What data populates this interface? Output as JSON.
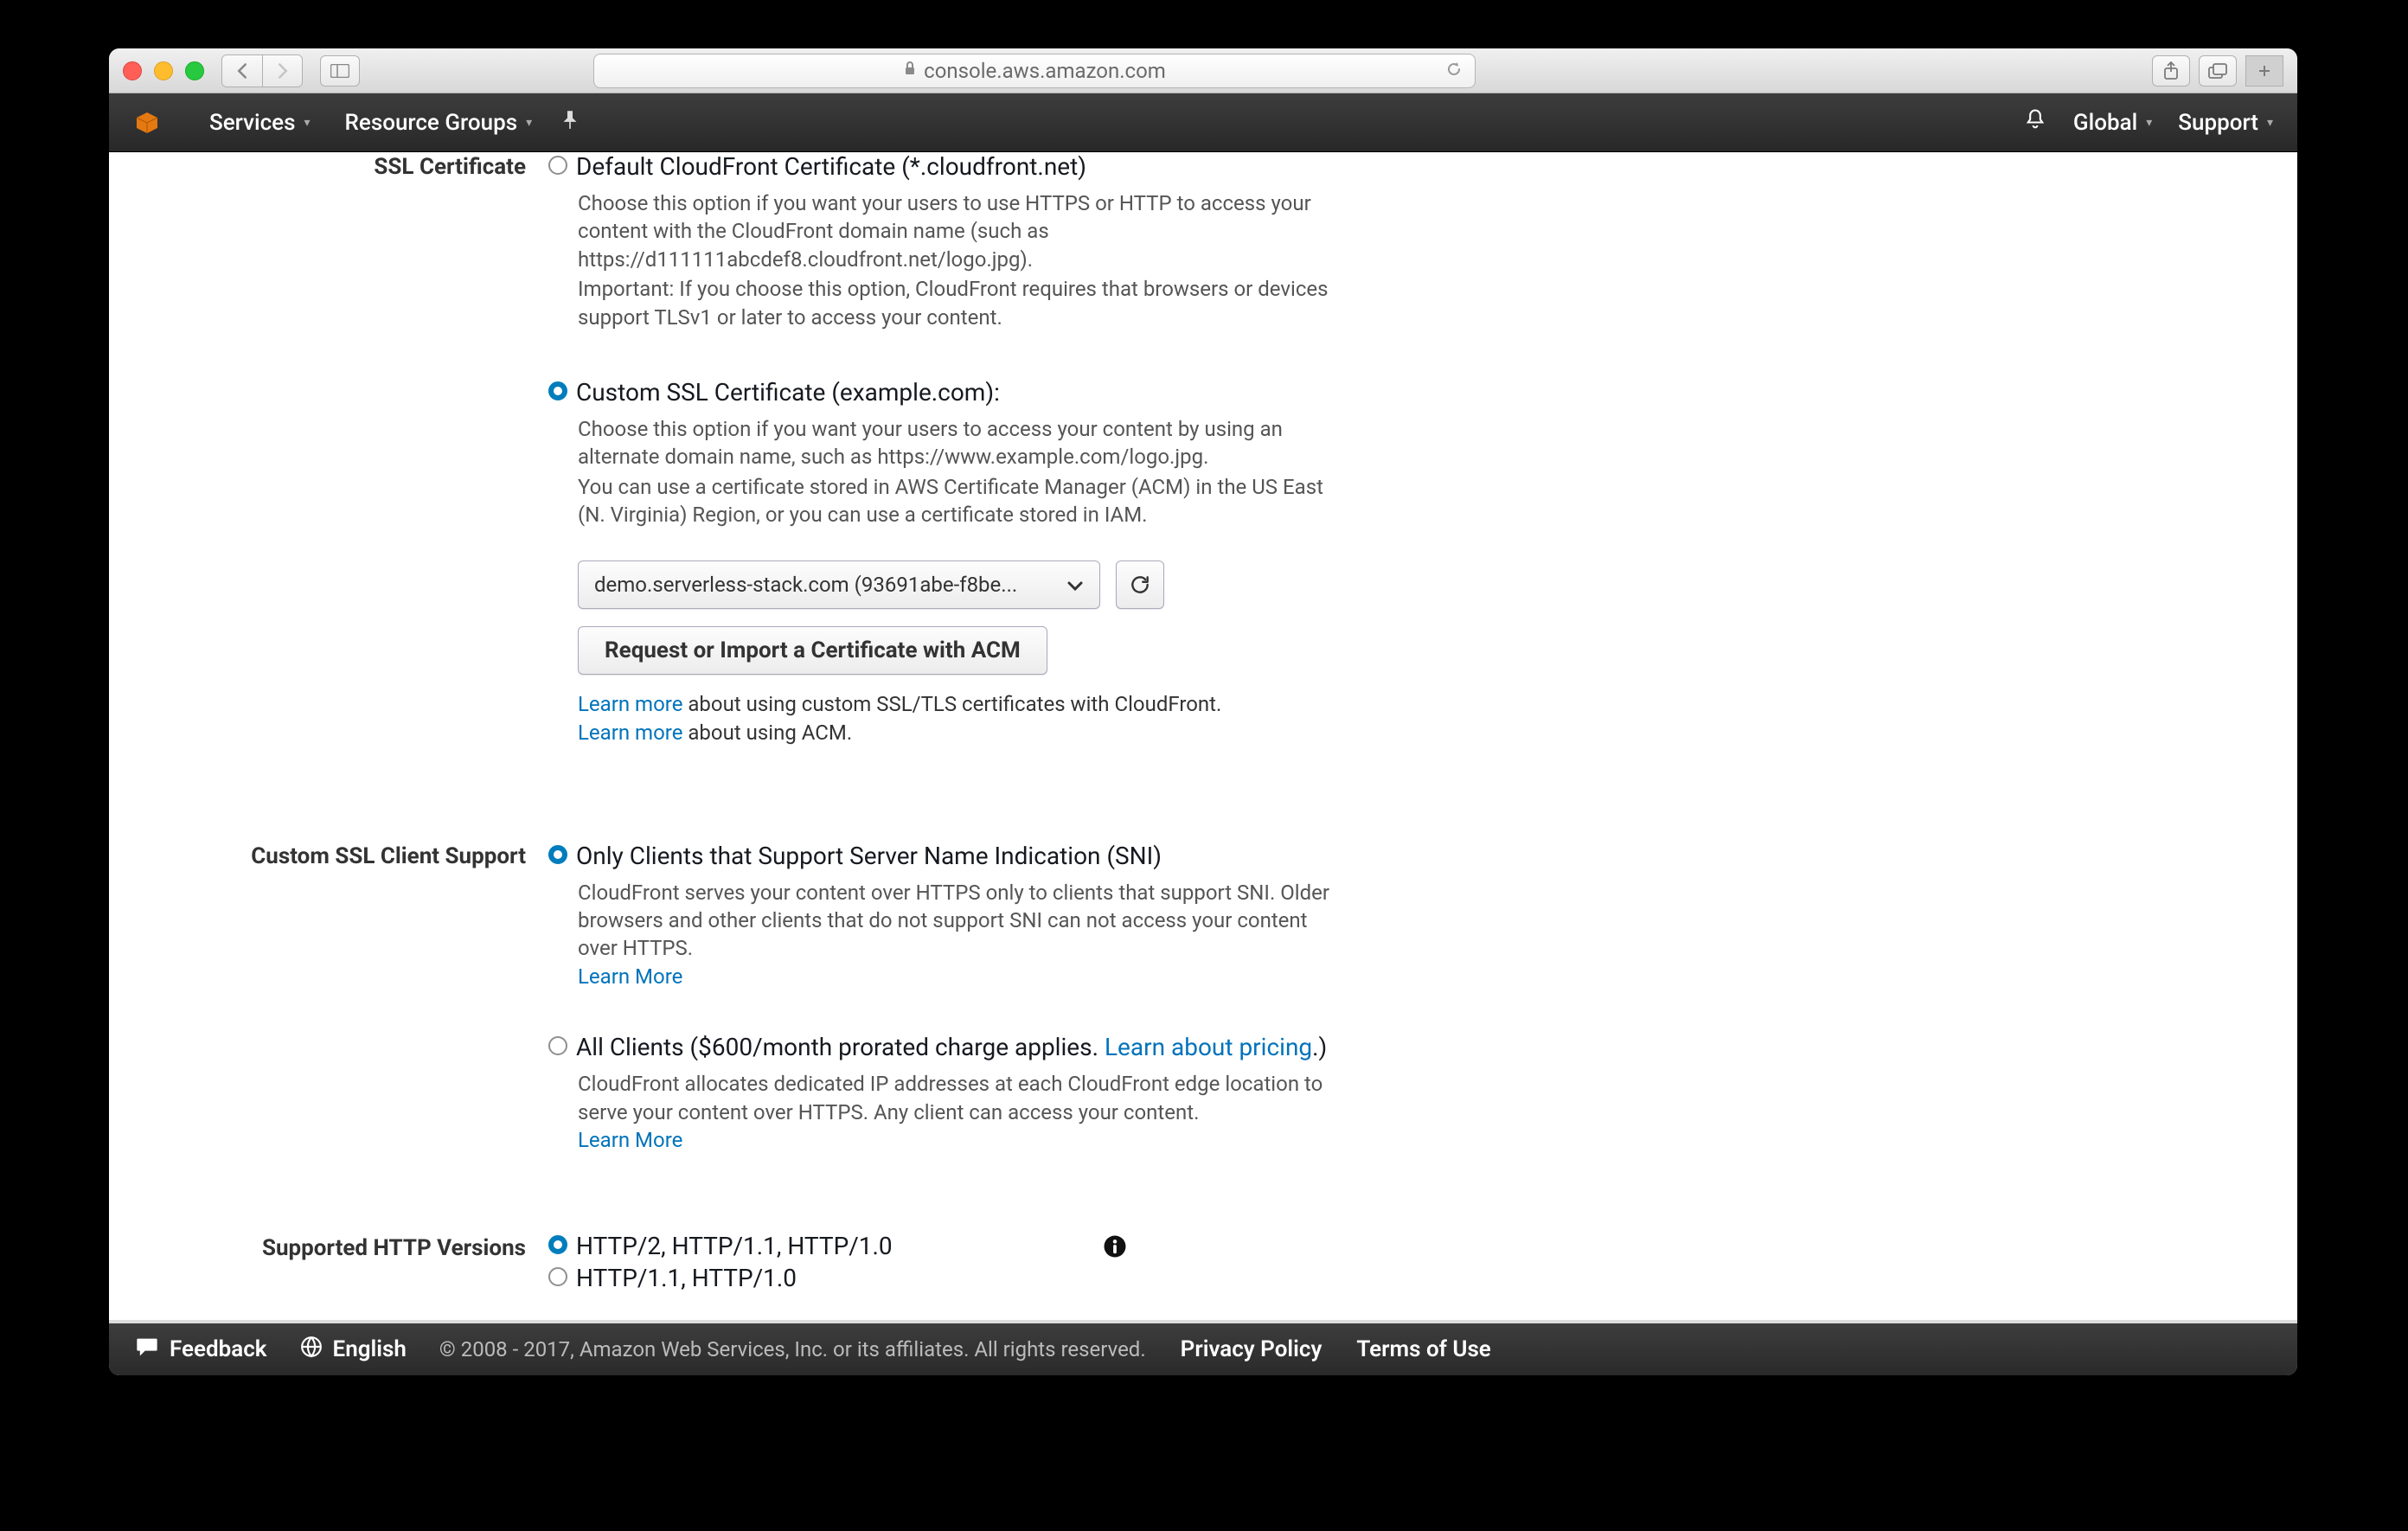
{
  "browser": {
    "url": "console.aws.amazon.com"
  },
  "nav": {
    "services": "Services",
    "resource_groups": "Resource Groups",
    "region": "Global",
    "support": "Support"
  },
  "ssl_cert": {
    "label": "SSL Certificate",
    "default_option": "Default CloudFront Certificate (*.cloudfront.net)",
    "default_help1": "Choose this option if you want your users to use HTTPS or HTTP to access your content with the CloudFront domain name (such as https://d111111abcdef8.cloudfront.net/logo.jpg).",
    "default_help2": "Important: If you choose this option, CloudFront requires that browsers or devices support TLSv1 or later to access your content.",
    "custom_option": "Custom SSL Certificate (example.com):",
    "custom_help1": "Choose this option if you want your users to access your content by using an alternate domain name, such as https://www.example.com/logo.jpg.",
    "custom_help2": "You can use a certificate stored in AWS Certificate Manager (ACM) in the US East (N. Virginia) Region, or you can use a certificate stored in IAM.",
    "cert_value": "demo.serverless-stack.com (93691abe-f8be...",
    "request_button": "Request or Import a Certificate with ACM",
    "learn_more": "Learn more",
    "learn_more_ssl_suffix": " about using custom SSL/TLS certificates with CloudFront.",
    "learn_more_acm_suffix": " about using ACM."
  },
  "sni": {
    "label": "Custom SSL Client Support",
    "sni_option": "Only Clients that Support Server Name Indication (SNI)",
    "sni_help": "CloudFront serves your content over HTTPS only to clients that support SNI. Older browsers and other clients that do not support SNI can not access your content over HTTPS.",
    "learn_more": "Learn More",
    "all_clients_prefix": "All Clients ($600/month prorated charge applies. ",
    "all_clients_link": "Learn about pricing",
    "all_clients_suffix": ".)",
    "all_clients_help": "CloudFront allocates dedicated IP addresses at each CloudFront edge location to serve your content over HTTPS. Any client can access your content."
  },
  "http": {
    "label": "Supported HTTP Versions",
    "option1": "HTTP/2, HTTP/1.1, HTTP/1.0",
    "option2": "HTTP/1.1, HTTP/1.0"
  },
  "footer": {
    "feedback": "Feedback",
    "language": "English",
    "copyright": "© 2008 - 2017, Amazon Web Services, Inc. or its affiliates. All rights reserved.",
    "privacy": "Privacy Policy",
    "terms": "Terms of Use"
  }
}
